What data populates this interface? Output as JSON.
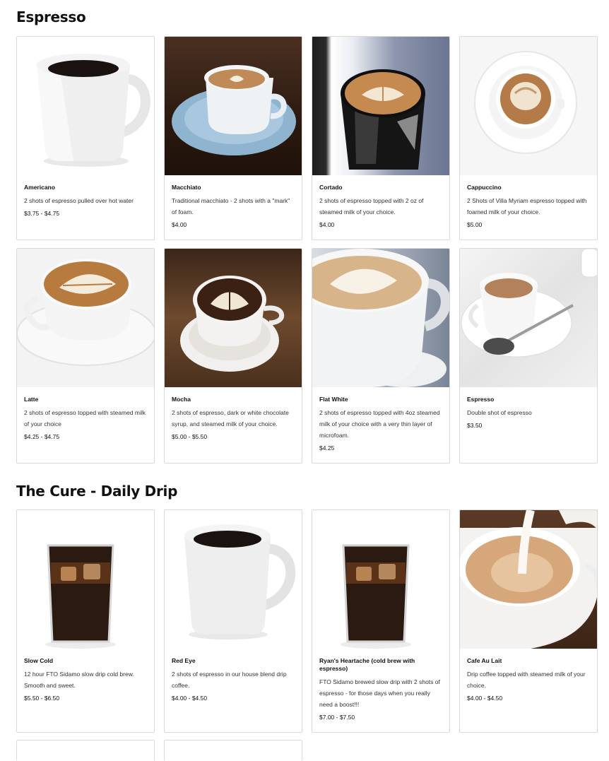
{
  "sections": [
    {
      "title": "Espresso",
      "items": [
        {
          "name": "Americano",
          "desc": "2 shots of espresso pulled over hot water",
          "price": "$3.75 - $4.75"
        },
        {
          "name": "Macchiato",
          "desc": "Traditional macchiato - 2 shots with a \"mark\" of foam.",
          "price": "$4.00"
        },
        {
          "name": "Cortado",
          "desc": "2 shots of espresso topped with 2 oz of steamed milk of your choice.",
          "price": "$4.00"
        },
        {
          "name": "Cappuccino",
          "desc": "2 Shots of Villa Myriam espresso topped with foamed milk of your choice.",
          "price": "$5.00"
        },
        {
          "name": "Latte",
          "desc": "2 shots of espresso topped with steamed milk of your choice",
          "price": "$4.25 - $4.75"
        },
        {
          "name": "Mocha",
          "desc": "2 shots of espresso, dark or white chocolate syrup, and steamed milk of your choice.",
          "price": "$5.00 - $5.50"
        },
        {
          "name": "Flat White",
          "desc": "2 shots of espresso topped with 4oz steamed milk of your choice with a very thin layer of microfoam.",
          "price": "$4.25"
        },
        {
          "name": "Espresso",
          "desc": "Double shot of espresso",
          "price": "$3.50"
        }
      ]
    },
    {
      "title": "The Cure - Daily Drip",
      "items": [
        {
          "name": "Slow Cold",
          "desc": "12 hour FTO Sidamo slow drip cold brew. Smooth and sweet.",
          "price": "$5.50 - $6.50"
        },
        {
          "name": "Red Eye",
          "desc": "2 shots of espresso in our house blend drip coffee.",
          "price": "$4.00 - $4.50"
        },
        {
          "name": "Ryan's Heartache (cold brew with espresso)",
          "desc": "FTO Sidamo brewed slow drip with 2 shots of espresso - for those days when you really need a boost!!!",
          "price": "$7.00 - $7.50"
        },
        {
          "name": "Cafe Au Lait",
          "desc": "Drip coffee topped with steamed milk of your choice.",
          "price": "$4.00 - $4.50"
        }
      ]
    }
  ]
}
